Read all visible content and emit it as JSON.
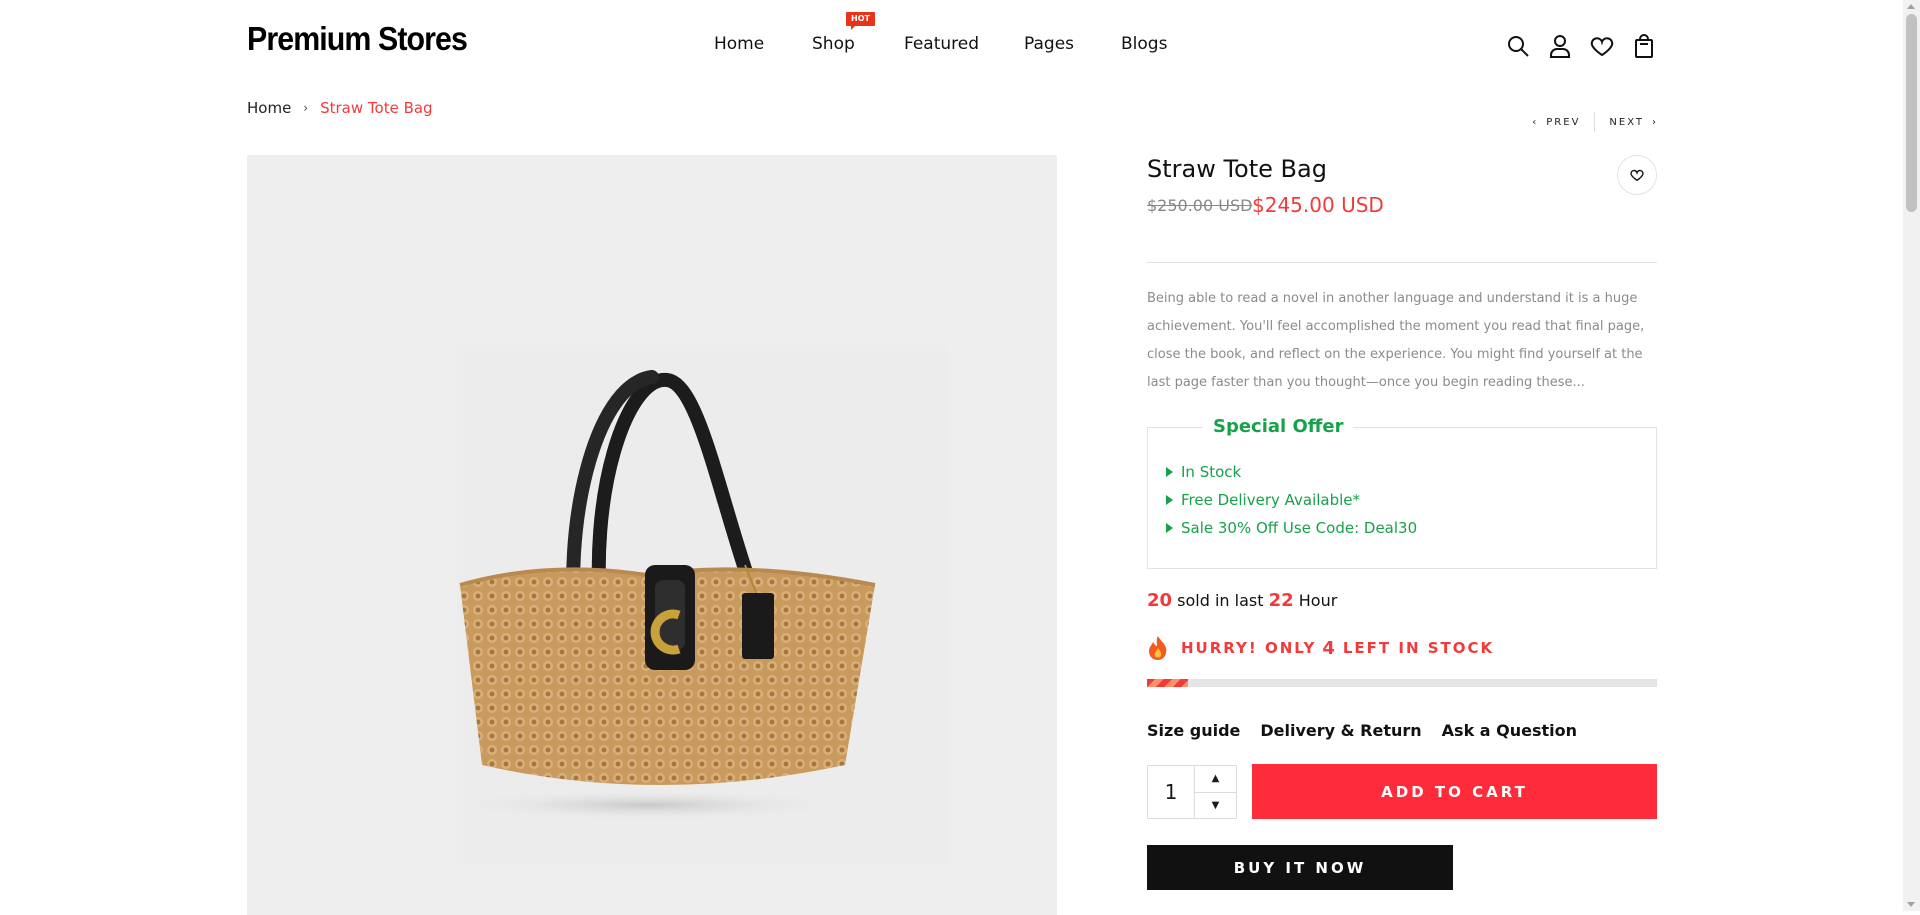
{
  "brand": "Premium Stores",
  "nav": [
    {
      "label": "Home"
    },
    {
      "label": "Shop"
    },
    {
      "label": "Featured"
    },
    {
      "label": "Pages"
    },
    {
      "label": "Blogs"
    }
  ],
  "nav_badge": "HOT",
  "header_icons": [
    "search-icon",
    "account-icon",
    "wishlist-icon",
    "cart-icon"
  ],
  "breadcrumb": {
    "home": "Home",
    "current": "Straw Tote Bag"
  },
  "pager": {
    "prev": "PREV",
    "next": "NEXT"
  },
  "product": {
    "title": "Straw Tote Bag",
    "price_old": "$250.00 USD",
    "price_new": "$245.00 USD",
    "description": "Being able to read a novel in another language and understand it is a huge achievement. You'll feel accomplished the moment you read that final page, close the book, and reflect on the experience. You might find yourself at the last page faster than you thought—once you begin reading these..."
  },
  "offer": {
    "title": "Special Offer",
    "items": [
      "In Stock",
      "Free Delivery Available*",
      "Sale 30% Off Use Code: Deal30"
    ]
  },
  "sold": {
    "count": "20",
    "text1": "sold in last",
    "hours": "22",
    "text2": "Hour"
  },
  "stock": {
    "prefix": "HURRY! ONLY",
    "count": "4",
    "suffix": "LEFT IN STOCK",
    "fraction": 0.08
  },
  "links": [
    "Size guide",
    "Delivery & Return",
    "Ask a Question"
  ],
  "quantity": "1",
  "buttons": {
    "add_to_cart": "ADD TO CART",
    "buy_now": "BUY IT NOW"
  },
  "colors": {
    "accent": "#fe2c3a",
    "price": "#f23a3a",
    "offer_green": "#17a14a"
  }
}
